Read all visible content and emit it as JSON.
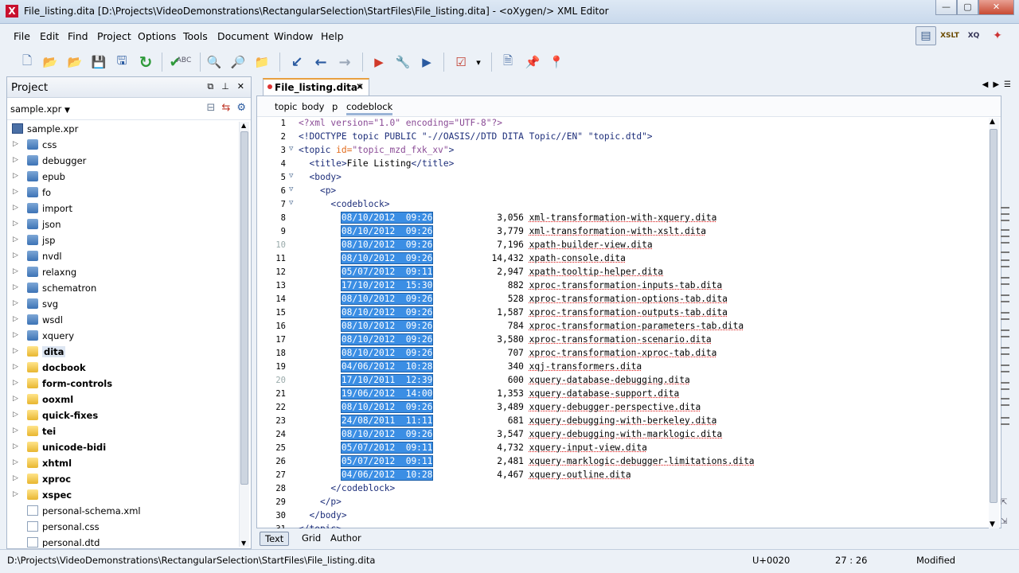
{
  "window": {
    "title": "File_listing.dita [D:\\Projects\\VideoDemonstrations\\RectangularSelection\\StartFiles\\File_listing.dita] - <oXygen/> XML Editor",
    "app_icon": "oxygen-x-icon",
    "minimize": "—",
    "maximize": "▢",
    "close": "✕"
  },
  "menu": [
    {
      "label": "File"
    },
    {
      "label": "Edit"
    },
    {
      "label": "Find"
    },
    {
      "label": "Project"
    },
    {
      "label": "Options"
    },
    {
      "label": "Tools"
    },
    {
      "label": "Document"
    },
    {
      "label": "Window"
    },
    {
      "label": "Help"
    }
  ],
  "perspectives": [
    {
      "name": "editor-perspective-icon",
      "text": "▤"
    },
    {
      "name": "xslt-debugger-perspective-icon",
      "text": "XSLT"
    },
    {
      "name": "xquery-debugger-perspective-icon",
      "text": "XQ"
    },
    {
      "name": "database-perspective-icon",
      "text": "✦"
    }
  ],
  "toolbar": [
    {
      "name": "new-file-icon",
      "glyph": "🗋"
    },
    {
      "name": "open-file-icon",
      "glyph": "📂"
    },
    {
      "name": "open-url-icon",
      "glyph": "📂"
    },
    {
      "name": "save-icon",
      "glyph": "💾"
    },
    {
      "name": "save-all-icon",
      "glyph": "🖫"
    },
    {
      "name": "reload-icon",
      "glyph": "↻"
    },
    {
      "name": "validate-icon",
      "glyph": "✔"
    },
    {
      "name": "spellcheck-icon",
      "glyph": "ABC"
    },
    {
      "name": "find-icon",
      "glyph": "🔍"
    },
    {
      "name": "find-in-files-icon",
      "glyph": "🔎"
    },
    {
      "name": "open-folder-icon",
      "glyph": "📁"
    },
    {
      "name": "go-to-icon",
      "glyph": "↙"
    },
    {
      "name": "back-icon",
      "glyph": "←"
    },
    {
      "name": "forward-icon",
      "glyph": "→"
    },
    {
      "name": "apply-transformation-icon",
      "glyph": "▶"
    },
    {
      "name": "configure-transformation-icon",
      "glyph": "🔧"
    },
    {
      "name": "debug-scenario-icon",
      "glyph": "▶"
    },
    {
      "name": "validate-scenario-icon",
      "glyph": "☑"
    },
    {
      "name": "dropdown-arrow-icon",
      "glyph": "▾"
    },
    {
      "name": "document-icon",
      "glyph": "🗎"
    },
    {
      "name": "pin-red-icon",
      "glyph": "📌"
    },
    {
      "name": "pin-green-icon",
      "glyph": "📍"
    }
  ],
  "project": {
    "title": "Project",
    "file": "sample.xpr",
    "tree": [
      {
        "label": "sample.xpr",
        "type": "project",
        "expand": false
      },
      {
        "label": "css",
        "type": "folder-blue",
        "expand": true
      },
      {
        "label": "debugger",
        "type": "folder-blue",
        "expand": true
      },
      {
        "label": "epub",
        "type": "folder-blue",
        "expand": true
      },
      {
        "label": "fo",
        "type": "folder-blue",
        "expand": true
      },
      {
        "label": "import",
        "type": "folder-blue",
        "expand": true
      },
      {
        "label": "json",
        "type": "folder-blue",
        "expand": true
      },
      {
        "label": "jsp",
        "type": "folder-blue",
        "expand": true
      },
      {
        "label": "nvdl",
        "type": "folder-blue",
        "expand": true
      },
      {
        "label": "relaxng",
        "type": "folder-blue",
        "expand": true
      },
      {
        "label": "schematron",
        "type": "folder-blue",
        "expand": true
      },
      {
        "label": "svg",
        "type": "folder-blue",
        "expand": true
      },
      {
        "label": "wsdl",
        "type": "folder-blue",
        "expand": true
      },
      {
        "label": "xquery",
        "type": "folder-blue",
        "expand": true
      },
      {
        "label": "dita",
        "type": "folder-yellow",
        "expand": true,
        "bold": true,
        "selected": true
      },
      {
        "label": "docbook",
        "type": "folder-yellow",
        "expand": true,
        "bold": true
      },
      {
        "label": "form-controls",
        "type": "folder-yellow",
        "expand": true,
        "bold": true
      },
      {
        "label": "ooxml",
        "type": "folder-yellow",
        "expand": true,
        "bold": true
      },
      {
        "label": "quick-fixes",
        "type": "folder-yellow",
        "expand": true,
        "bold": true
      },
      {
        "label": "tei",
        "type": "folder-yellow",
        "expand": true,
        "bold": true
      },
      {
        "label": "unicode-bidi",
        "type": "folder-yellow",
        "expand": true,
        "bold": true
      },
      {
        "label": "xhtml",
        "type": "folder-yellow",
        "expand": true,
        "bold": true
      },
      {
        "label": "xproc",
        "type": "folder-yellow",
        "expand": true,
        "bold": true
      },
      {
        "label": "xspec",
        "type": "folder-yellow",
        "expand": true,
        "bold": true
      },
      {
        "label": "personal-schema.xml",
        "type": "file",
        "expand": false
      },
      {
        "label": "personal.css",
        "type": "file",
        "expand": false
      },
      {
        "label": "personal.dtd",
        "type": "file",
        "expand": false
      }
    ]
  },
  "editor": {
    "tab_label": "File_listing.dita*",
    "tab_close": "✕",
    "breadcrumb": [
      "topic",
      "body",
      "p",
      "codeblock"
    ],
    "modes": [
      "Text",
      "Grid",
      "Author"
    ],
    "active_mode": "Text",
    "header_lines": [
      {
        "n": "1",
        "fold": "",
        "indent": "",
        "parts": [
          [
            "decl",
            "<?xml version=\"1.0\" encoding=\"UTF-8\"?>"
          ]
        ]
      },
      {
        "n": "2",
        "fold": "",
        "indent": "",
        "parts": [
          [
            "tag",
            "<!DOCTYPE topic PUBLIC \"-//OASIS//DTD DITA Topic//EN\" \"topic.dtd\">"
          ]
        ]
      },
      {
        "n": "3",
        "fold": "▽",
        "indent": "",
        "parts": [
          [
            "tag",
            "<topic "
          ],
          [
            "attn",
            "id="
          ],
          [
            "attv",
            "\"topic_mzd_fxk_xv\""
          ],
          [
            "tag",
            ">"
          ]
        ]
      },
      {
        "n": "4",
        "fold": "",
        "indent": "  ",
        "parts": [
          [
            "tag",
            "<title>"
          ],
          [
            "txt",
            "File Listing"
          ],
          [
            "tag",
            "</title>"
          ]
        ]
      },
      {
        "n": "5",
        "fold": "▽",
        "indent": "  ",
        "parts": [
          [
            "tag",
            "<body>"
          ]
        ]
      },
      {
        "n": "6",
        "fold": "▽",
        "indent": "    ",
        "parts": [
          [
            "tag",
            "<p>"
          ]
        ]
      },
      {
        "n": "7",
        "fold": "▽",
        "indent": "      ",
        "parts": [
          [
            "tag",
            "<codeblock>"
          ]
        ]
      }
    ],
    "listing": [
      {
        "n": "8",
        "date": "08/10/2012",
        "time": "09:26",
        "size": "3,056",
        "file": "xml-transformation-with-xquery.dita"
      },
      {
        "n": "9",
        "date": "08/10/2012",
        "time": "09:26",
        "size": "3,779",
        "file": "xml-transformation-with-xslt.dita"
      },
      {
        "n": "10",
        "date": "08/10/2012",
        "time": "09:26",
        "size": "7,196",
        "file": "xpath-builder-view.dita",
        "gray": true
      },
      {
        "n": "11",
        "date": "08/10/2012",
        "time": "09:26",
        "size": "14,432",
        "file": "xpath-console.dita"
      },
      {
        "n": "12",
        "date": "05/07/2012",
        "time": "09:11",
        "size": "2,947",
        "file": "xpath-tooltip-helper.dita"
      },
      {
        "n": "13",
        "date": "17/10/2012",
        "time": "15:30",
        "size": "882",
        "file": "xproc-transformation-inputs-tab.dita"
      },
      {
        "n": "14",
        "date": "08/10/2012",
        "time": "09:26",
        "size": "528",
        "file": "xproc-transformation-options-tab.dita"
      },
      {
        "n": "15",
        "date": "08/10/2012",
        "time": "09:26",
        "size": "1,587",
        "file": "xproc-transformation-outputs-tab.dita"
      },
      {
        "n": "16",
        "date": "08/10/2012",
        "time": "09:26",
        "size": "784",
        "file": "xproc-transformation-parameters-tab.dita"
      },
      {
        "n": "17",
        "date": "08/10/2012",
        "time": "09:26",
        "size": "3,580",
        "file": "xproc-transformation-scenario.dita"
      },
      {
        "n": "18",
        "date": "08/10/2012",
        "time": "09:26",
        "size": "707",
        "file": "xproc-transformation-xproc-tab.dita"
      },
      {
        "n": "19",
        "date": "04/06/2012",
        "time": "10:28",
        "size": "340",
        "file": "xqj-transformers.dita"
      },
      {
        "n": "20",
        "date": "17/10/2011",
        "time": "12:39",
        "size": "600",
        "file": "xquery-database-debugging.dita",
        "gray": true
      },
      {
        "n": "21",
        "date": "19/06/2012",
        "time": "14:00",
        "size": "1,353",
        "file": "xquery-database-support.dita"
      },
      {
        "n": "22",
        "date": "08/10/2012",
        "time": "09:26",
        "size": "3,489",
        "file": "xquery-debugger-perspective.dita"
      },
      {
        "n": "23",
        "date": "24/08/2011",
        "time": "11:11",
        "size": "681",
        "file": "xquery-debugging-with-berkeley.dita"
      },
      {
        "n": "24",
        "date": "08/10/2012",
        "time": "09:26",
        "size": "3,547",
        "file": "xquery-debugging-with-marklogic.dita"
      },
      {
        "n": "25",
        "date": "05/07/2012",
        "time": "09:11",
        "size": "4,732",
        "file": "xquery-input-view.dita"
      },
      {
        "n": "26",
        "date": "05/07/2012",
        "time": "09:11",
        "size": "2,481",
        "file": "xquery-marklogic-debugger-limitations.dita"
      },
      {
        "n": "27",
        "date": "04/06/2012",
        "time": "10:28",
        "size": "4,467",
        "file": "xquery-outline.dita"
      }
    ],
    "footer_lines": [
      {
        "n": "28",
        "indent": "      ",
        "parts": [
          [
            "tag",
            "</codeblock>"
          ]
        ]
      },
      {
        "n": "29",
        "indent": "    ",
        "parts": [
          [
            "tag",
            "</p>"
          ]
        ]
      },
      {
        "n": "30",
        "indent": "  ",
        "parts": [
          [
            "tag",
            "</body>"
          ]
        ]
      },
      {
        "n": "31",
        "indent": "",
        "parts": [
          [
            "tag",
            "</topic>"
          ]
        ]
      }
    ]
  },
  "status": {
    "path": "D:\\Projects\\VideoDemonstrations\\RectangularSelection\\StartFiles\\File_listing.dita",
    "unicode": "U+0020",
    "position": "27 : 26",
    "state": "Modified"
  },
  "colors": {
    "selection": "#3b8ee4",
    "tag": "#1d2e7a",
    "attribute_name": "#e16a1a",
    "attribute_value": "#8a4b96"
  }
}
